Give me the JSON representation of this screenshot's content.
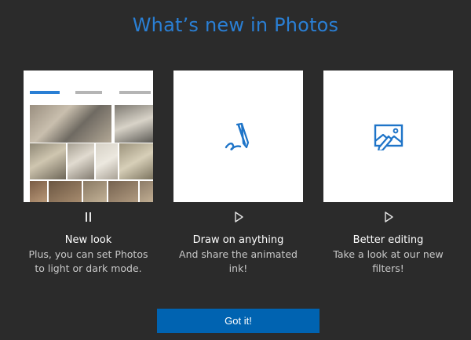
{
  "header": {
    "title": "What’s new in Photos"
  },
  "cards": [
    {
      "title": "New look",
      "description": "Plus, you can set Photos to light or dark mode.",
      "media_state": "playing",
      "control_icon": "pause-icon"
    },
    {
      "title": "Draw on anything",
      "description": "And share the animated ink!",
      "media_state": "paused",
      "control_icon": "play-icon",
      "illustration_icon": "pen-ink-icon"
    },
    {
      "title": "Better editing",
      "description": "Take a look at our new filters!",
      "media_state": "paused",
      "control_icon": "play-icon",
      "illustration_icon": "photo-edit-icon"
    }
  ],
  "actions": {
    "confirm_label": "Got it!"
  },
  "colors": {
    "background": "#2b2b2b",
    "accent": "#2a7fd4",
    "button": "#0063b1"
  }
}
